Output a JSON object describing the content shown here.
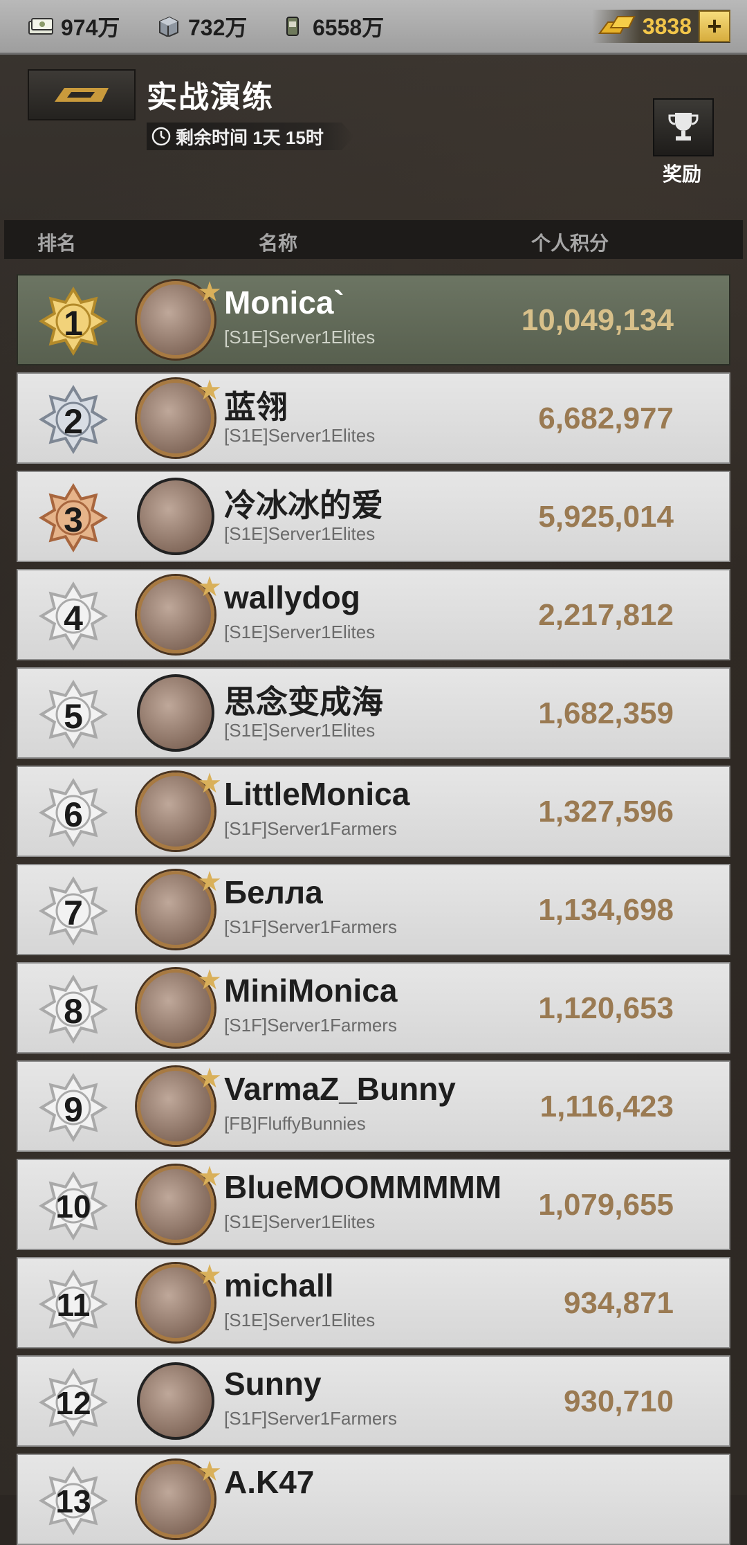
{
  "resources": {
    "cash": "974万",
    "steel": "732万",
    "supplies": "6558万",
    "gold": "3838"
  },
  "header": {
    "title": "实战演练",
    "timer": "剩余时间 1天 15时",
    "reward_label": "奖励"
  },
  "columns": {
    "rank": "排名",
    "name": "名称",
    "score": "个人积分"
  },
  "rows": [
    {
      "rank": "1",
      "name": "Monica`",
      "guild": "[S1E]Server1Elites",
      "score": "10,049,134"
    },
    {
      "rank": "2",
      "name": "蓝翎",
      "guild": "[S1E]Server1Elites",
      "score": "6,682,977"
    },
    {
      "rank": "3",
      "name": "冷冰冰的爱",
      "guild": "[S1E]Server1Elites",
      "score": "5,925,014"
    },
    {
      "rank": "4",
      "name": "wallydog",
      "guild": "[S1E]Server1Elites",
      "score": "2,217,812"
    },
    {
      "rank": "5",
      "name": "思念变成海",
      "guild": "[S1E]Server1Elites",
      "score": "1,682,359"
    },
    {
      "rank": "6",
      "name": "LittleMonica",
      "guild": "[S1F]Server1Farmers",
      "score": "1,327,596"
    },
    {
      "rank": "7",
      "name": "Белла",
      "guild": "[S1F]Server1Farmers",
      "score": "1,134,698"
    },
    {
      "rank": "8",
      "name": "MiniMonica",
      "guild": "[S1F]Server1Farmers",
      "score": "1,120,653"
    },
    {
      "rank": "9",
      "name": "VarmaZ_Bunny",
      "guild": "[FB]FluffyBunnies",
      "score": "1,116,423"
    },
    {
      "rank": "10",
      "name": "BlueMOOMMMMM",
      "guild": "[S1E]Server1Elites",
      "score": "1,079,655"
    },
    {
      "rank": "11",
      "name": "michall",
      "guild": "[S1E]Server1Elites",
      "score": "934,871"
    },
    {
      "rank": "12",
      "name": "Sunny",
      "guild": "[S1F]Server1Farmers",
      "score": "930,710"
    },
    {
      "rank": "13",
      "name": "A.K47",
      "guild": "",
      "score": ""
    }
  ]
}
